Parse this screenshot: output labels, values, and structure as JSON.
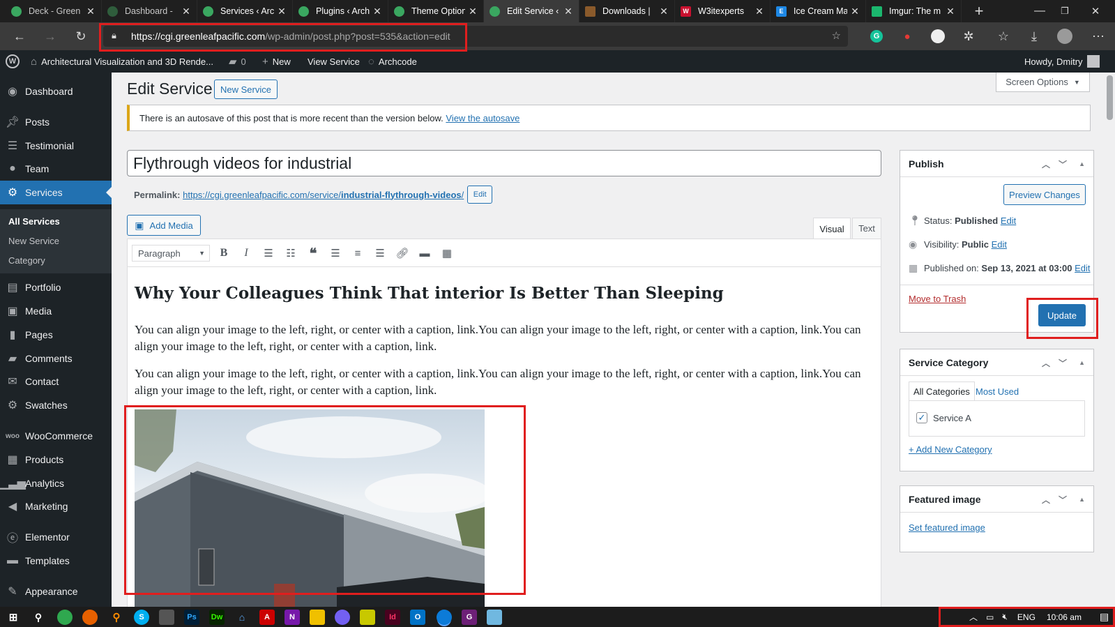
{
  "browser": {
    "tabs": [
      {
        "title": "Deck - Green",
        "active": false
      },
      {
        "title": "Dashboard -",
        "active": false
      },
      {
        "title": "Services ‹ Arc",
        "active": false
      },
      {
        "title": "Plugins ‹ Arch",
        "active": false
      },
      {
        "title": "Theme Option",
        "active": false
      },
      {
        "title": "Edit Service ‹",
        "active": true
      },
      {
        "title": "Downloads |",
        "active": false
      },
      {
        "title": "W3itexperts",
        "active": false
      },
      {
        "title": "Ice Cream Ma",
        "active": false
      },
      {
        "title": "Imgur: The m",
        "active": false
      }
    ],
    "url_domain": "https://cgi.greenleafpacific.com",
    "url_path": "/wp-admin/post.php?post=535&action=edit"
  },
  "adminbar": {
    "site_name": "Architectural Visualization and 3D Rende...",
    "comments_count": "0",
    "new_label": "New",
    "view_label": "View Service",
    "archcode_label": "Archcode",
    "howdy": "Howdy, Dmitry"
  },
  "sidebar": {
    "items": [
      {
        "label": "Dashboard",
        "icon": "dashboard-icon"
      },
      {
        "label": "Posts",
        "icon": "pin-icon"
      },
      {
        "label": "Testimonial",
        "icon": "testimonial-icon"
      },
      {
        "label": "Team",
        "icon": "user-icon"
      },
      {
        "label": "Services",
        "icon": "gear-icon"
      },
      {
        "label": "Portfolio",
        "icon": "portfolio-icon"
      },
      {
        "label": "Media",
        "icon": "media-icon"
      },
      {
        "label": "Pages",
        "icon": "pages-icon"
      },
      {
        "label": "Comments",
        "icon": "comment-icon"
      },
      {
        "label": "Contact",
        "icon": "mail-icon"
      },
      {
        "label": "Swatches",
        "icon": "gear-icon"
      },
      {
        "label": "WooCommerce",
        "icon": "woo-icon"
      },
      {
        "label": "Products",
        "icon": "products-icon"
      },
      {
        "label": "Analytics",
        "icon": "chart-icon"
      },
      {
        "label": "Marketing",
        "icon": "megaphone-icon"
      },
      {
        "label": "Elementor",
        "icon": "elementor-icon"
      },
      {
        "label": "Templates",
        "icon": "folder-icon"
      },
      {
        "label": "Appearance",
        "icon": "brush-icon"
      }
    ],
    "submenu": [
      "All Services",
      "New Service",
      "Category"
    ]
  },
  "page": {
    "title": "Edit Service",
    "new_button": "New Service",
    "screen_options": "Screen Options",
    "notice_text": "There is an autosave of this post that is more recent than the version below.",
    "notice_link": "View the autosave",
    "post_title": "Flythrough videos for industrial",
    "permalink_label": "Permalink:",
    "permalink_base": "https://cgi.greenleafpacific.com/service/",
    "permalink_slug": "industrial-flythrough-videos",
    "permalink_end": "/",
    "permalink_edit": "Edit",
    "add_media": "Add Media",
    "tab_visual": "Visual",
    "tab_text": "Text",
    "format_select": "Paragraph"
  },
  "content": {
    "heading": "Why Your Colleagues Think That interior Is Better Than Sleeping",
    "paragraph1": "You can align your image to the left, right, or center with a caption, link.You can align your image to the left, right, or center with a caption, link.You can align your image to the left, right, or center with a caption, link.",
    "paragraph2": "You can align your image to the left, right, or center with a caption, link.You can align your image to the left, right, or center with a caption, link.You can align your image to the left, right, or center with a caption, link."
  },
  "publish": {
    "title": "Publish",
    "preview": "Preview Changes",
    "status_label": "Status:",
    "status_value": "Published",
    "visibility_label": "Visibility:",
    "visibility_value": "Public",
    "published_label": "Published on:",
    "published_value": "Sep 13, 2021 at 03:00",
    "edit": "Edit",
    "trash": "Move to Trash",
    "update": "Update"
  },
  "category_box": {
    "title": "Service Category",
    "tab_all": "All Categories",
    "tab_most": "Most Used",
    "item": "Service A",
    "item_checked": true,
    "add_new": "+ Add New Category"
  },
  "featured_box": {
    "title": "Featured image",
    "link": "Set featured image"
  },
  "taskbar": {
    "lang": "ENG",
    "time": "10:06 am"
  },
  "colors": {
    "admin_dark": "#1d2327",
    "wp_blue": "#2271b1",
    "highlight_red": "#e01e1e",
    "notice_yellow": "#dba617"
  }
}
